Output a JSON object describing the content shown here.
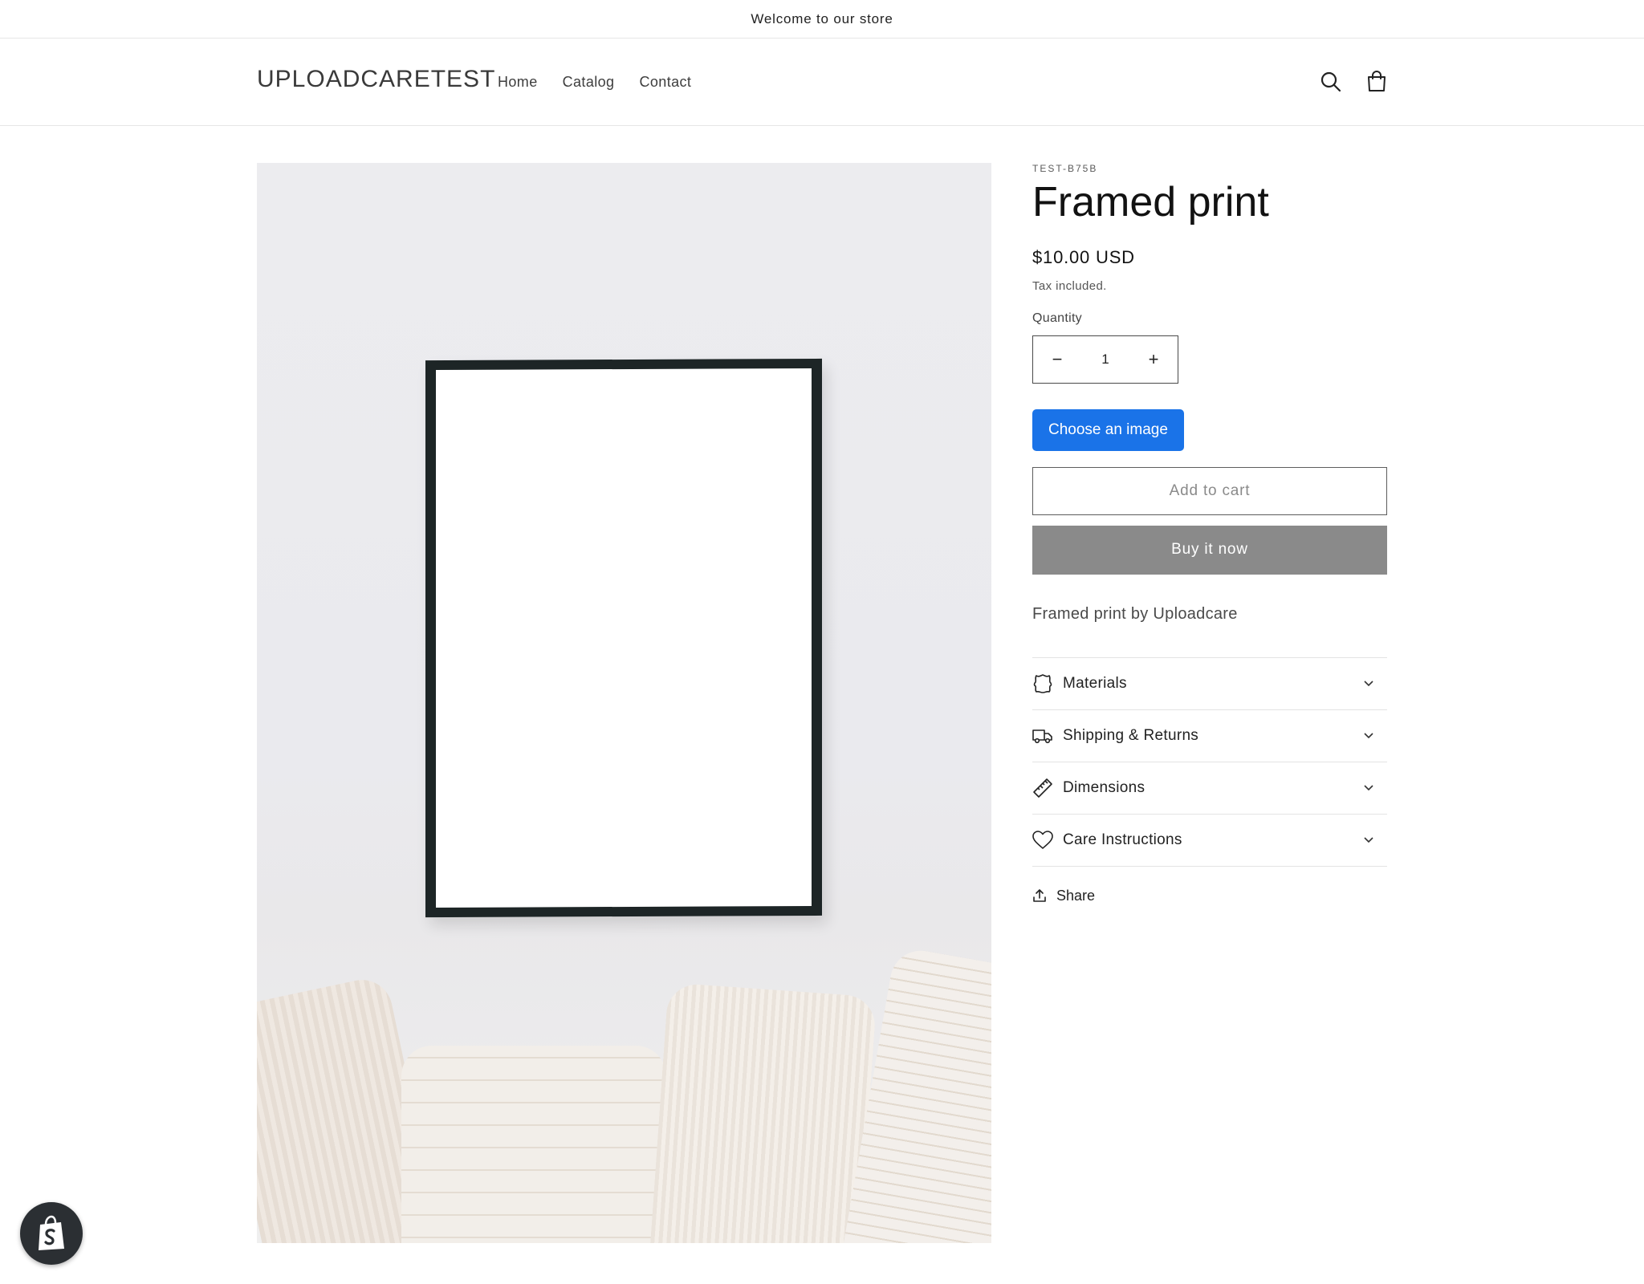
{
  "announcement": {
    "text": "Welcome to our store"
  },
  "header": {
    "logo": "UPLOADCARETEST",
    "nav": [
      {
        "label": "Home"
      },
      {
        "label": "Catalog"
      },
      {
        "label": "Contact"
      }
    ],
    "icons": [
      "search-icon",
      "cart-icon"
    ]
  },
  "product": {
    "sku": "TEST-B75B",
    "title": "Framed print",
    "price": "$10.00 USD",
    "tax_note": "Tax included.",
    "quantity_label": "Quantity",
    "quantity_value": "1",
    "minus_symbol": "−",
    "plus_symbol": "+",
    "choose_image_label": "Choose an image",
    "add_to_cart_label": "Add to cart",
    "buy_now_label": "Buy it now",
    "description": "Framed print by Uploadcare",
    "accordion": [
      {
        "label": "Materials",
        "icon": "puzzle-icon"
      },
      {
        "label": "Shipping & Returns",
        "icon": "truck-icon"
      },
      {
        "label": "Dimensions",
        "icon": "ruler-icon"
      },
      {
        "label": "Care Instructions",
        "icon": "heart-icon"
      }
    ],
    "share_label": "Share"
  },
  "colors": {
    "choose_button": "#1a73e8",
    "buy_button": "#8a8a8a",
    "shopify_badge": "#2b2f33"
  }
}
